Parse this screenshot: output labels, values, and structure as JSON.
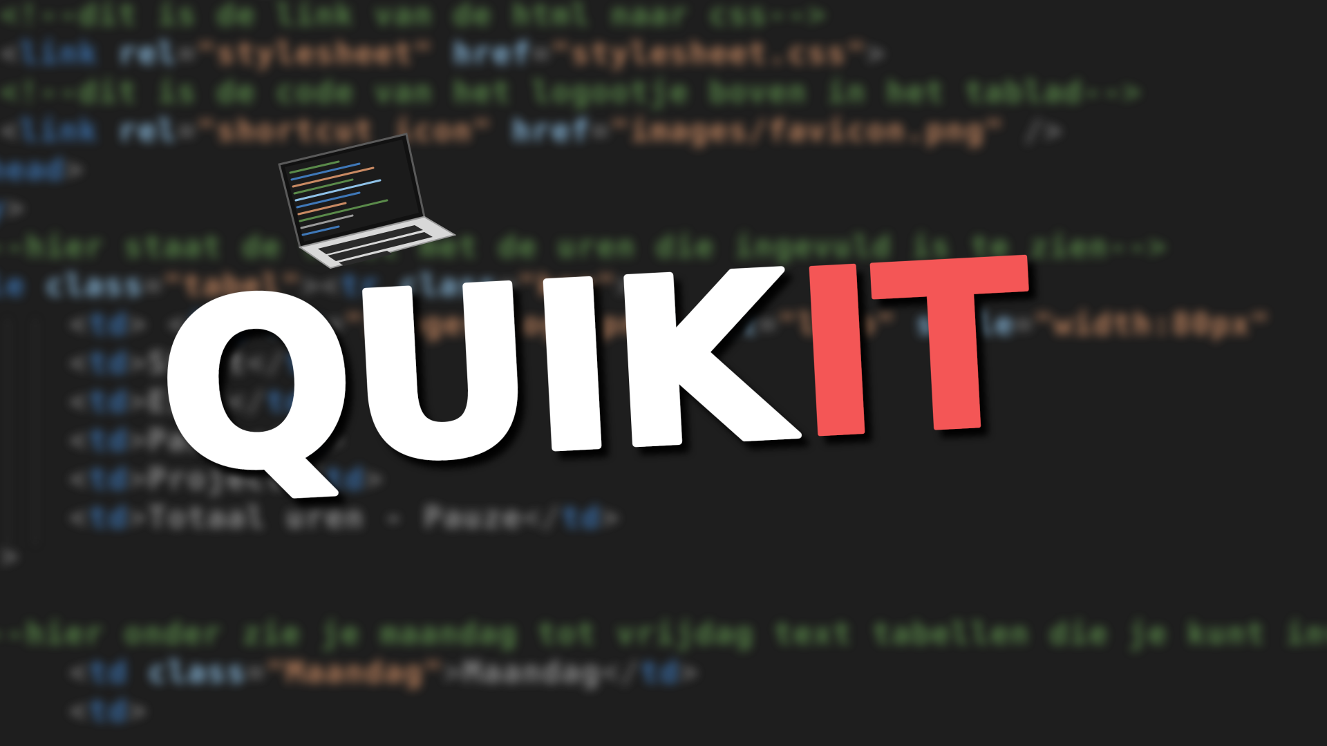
{
  "logo": {
    "word_1": "QUIK",
    "word_2": "IT",
    "color_white": "#ffffff",
    "color_red": "#f45656",
    "shadow_color": "#000000"
  },
  "decor": {
    "laptop_icon": "laptop-icon"
  }
}
